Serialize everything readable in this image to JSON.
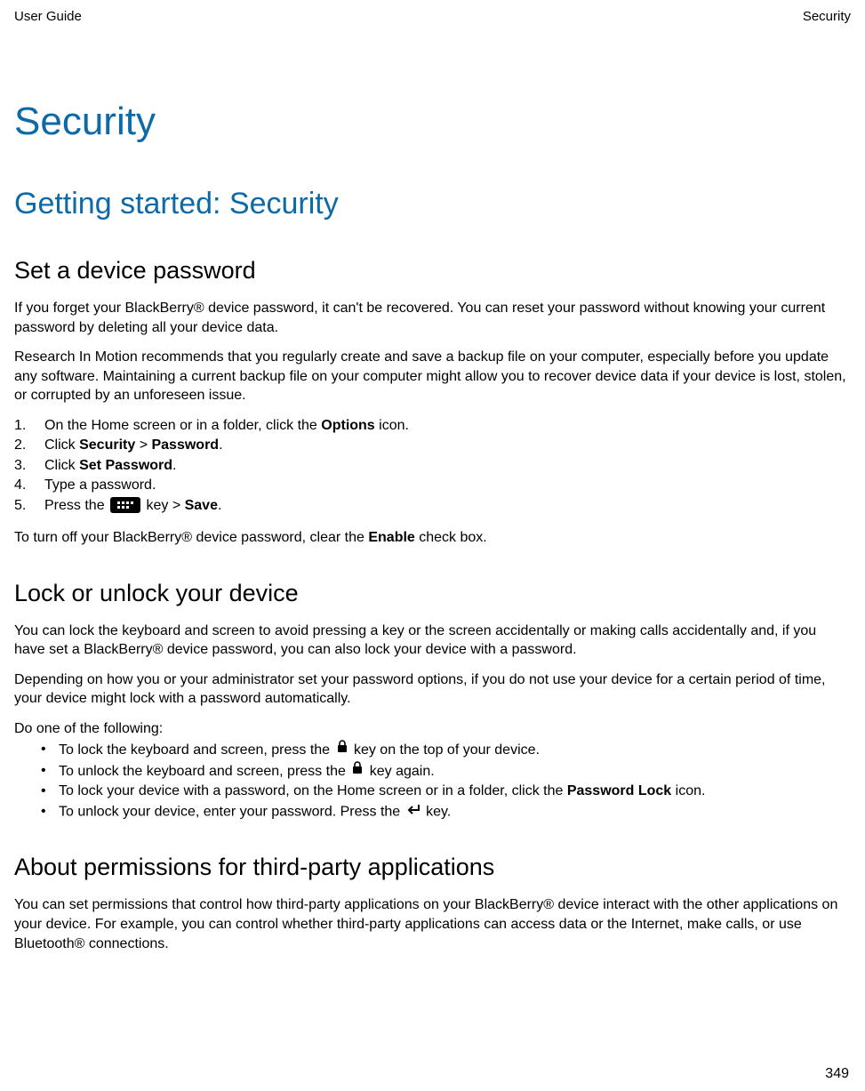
{
  "header": {
    "left": "User Guide",
    "right": "Security"
  },
  "h1": "Security",
  "h2": "Getting started: Security",
  "section1": {
    "heading": "Set a device password",
    "p1": "If you forget your BlackBerry® device password, it can't be recovered. You can reset your password without knowing your current password by deleting all your device data.",
    "p2": "Research In Motion recommends that you regularly create and save a backup file on your computer, especially before you update any software. Maintaining a current backup file on your computer might allow you to recover device data if your device is lost, stolen, or corrupted by an unforeseen issue.",
    "step1_pre": "On the Home screen or in a folder, click the ",
    "step1_bold": "Options",
    "step1_post": " icon.",
    "step2_pre": "Click ",
    "step2_b1": "Security",
    "step2_mid": " > ",
    "step2_b2": "Password",
    "step2_post": ".",
    "step3_pre": "Click ",
    "step3_bold": "Set Password",
    "step3_post": ".",
    "step4": "Type a password.",
    "step5_pre": "Press the ",
    "step5_mid": " key > ",
    "step5_bold": "Save",
    "step5_post": ".",
    "p3_pre": "To turn off your BlackBerry® device password, clear the ",
    "p3_bold": "Enable",
    "p3_post": " check box."
  },
  "section2": {
    "heading": "Lock or unlock your device",
    "p1": "You can lock the keyboard and screen to avoid pressing a key or the screen accidentally or making calls accidentally and, if you have set a BlackBerry® device password, you can also lock your device with a password.",
    "p2": "Depending on how you or your administrator set your password options, if you do not use your device for a certain period of time, your device might lock with a password automatically.",
    "p3": "Do one of the following:",
    "b1_pre": "To lock the keyboard and screen, press the ",
    "b1_post": " key on the top of your device.",
    "b2_pre": "To unlock the keyboard and screen, press the ",
    "b2_post": " key again.",
    "b3_pre": "To lock your device with a password, on the Home screen or in a folder, click the ",
    "b3_bold": "Password Lock",
    "b3_post": " icon.",
    "b4_pre": "To unlock your device, enter your password. Press the ",
    "b4_post": " key."
  },
  "section3": {
    "heading": "About permissions for third-party applications",
    "p1": "You can set permissions that control how third-party applications on your BlackBerry® device interact with the other applications on your device. For example, you can control whether third-party applications can access data or the Internet, make calls, or use Bluetooth® connections."
  },
  "page_number": "349"
}
